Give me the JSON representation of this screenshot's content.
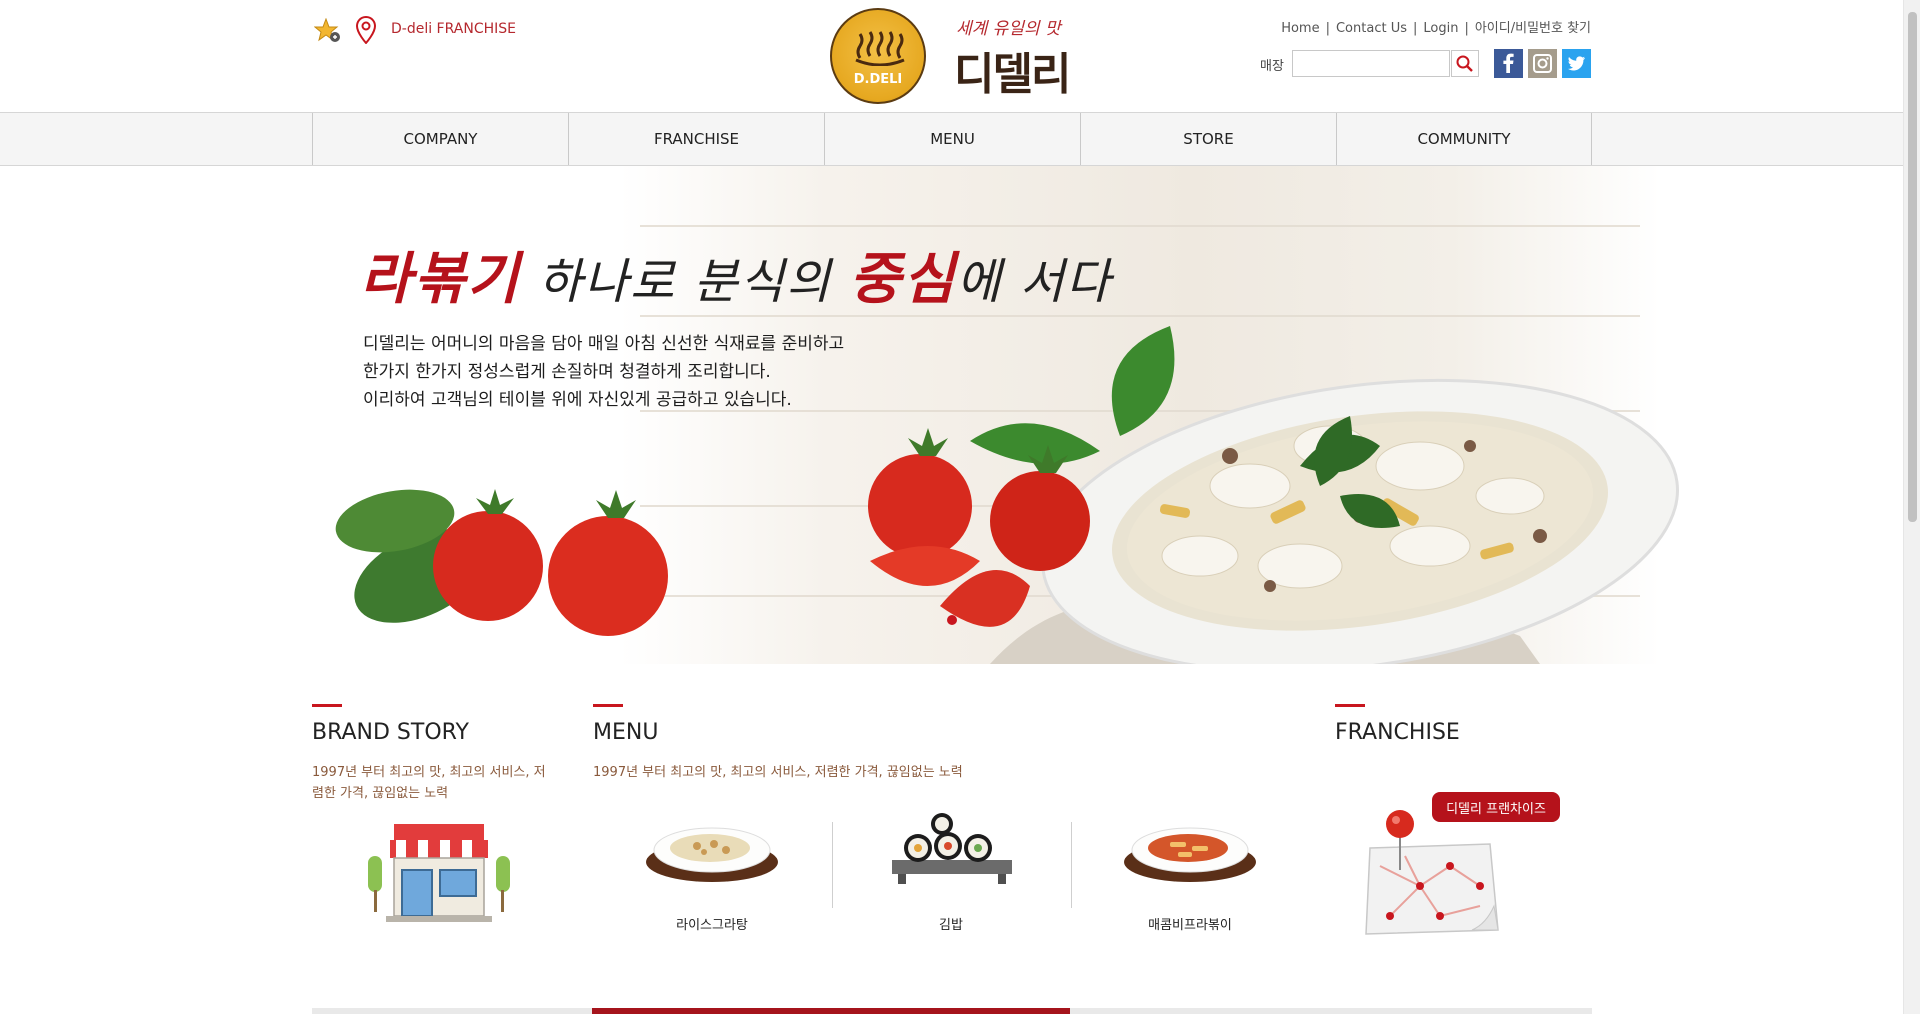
{
  "header": {
    "franchise_link": "D-deli FRANCHISE",
    "logo": {
      "circle_text": "D.DELI",
      "tagline": "세계 유일의 맛",
      "name": "디델리"
    },
    "util_links": [
      "Home",
      "Contact Us",
      "Login",
      "아이디/비밀번호 찾기"
    ],
    "search": {
      "label": "매장",
      "value": "",
      "placeholder": ""
    },
    "social": [
      "facebook",
      "instagram",
      "twitter"
    ]
  },
  "nav": {
    "items": [
      "COMPANY",
      "FRANCHISE",
      "MENU",
      "STORE",
      "COMMUNITY"
    ]
  },
  "hero": {
    "headline": {
      "part1": "라볶기",
      "part2": " 하나로 분식의 ",
      "part3": "중심",
      "part4": "에 서다"
    },
    "lines": [
      "디델리는 어머니의 마음을 담아 매일 아침 신선한 식재료를 준비하고",
      "한가지 한가지 정성스럽게 손질하며 청결하게 조리합니다.",
      "이리하여 고객님의 테이블 위에 자신있게 공급하고 있습니다."
    ]
  },
  "sections": {
    "brand": {
      "title": "BRAND STORY",
      "desc_line1": "1997년 부터 최고의 맛, 최고의 서비스, 저",
      "desc_line2": "렴한 가격, 끊임없는 노력"
    },
    "menu": {
      "title": "MENU",
      "desc": "1997년 부터 최고의 맛, 최고의 서비스, 저렴한 가격, 끊임없는 노력",
      "items": [
        "라이스그라탕",
        "김밥",
        "매콤비프라볶이"
      ]
    },
    "franchise": {
      "title": "FRANCHISE",
      "badge": "디델리 프랜차이즈"
    }
  },
  "colors": {
    "accent": "#b5121b",
    "brand_brown": "#3a2416"
  }
}
